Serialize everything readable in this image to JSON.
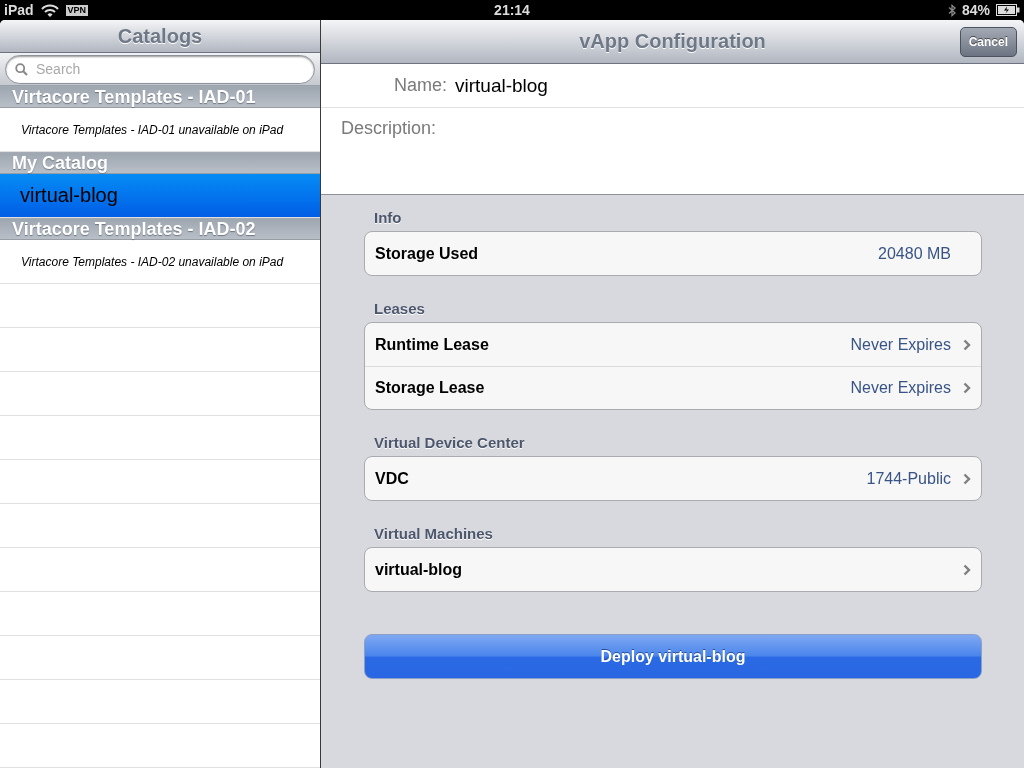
{
  "status_bar": {
    "device": "iPad",
    "vpn": "VPN",
    "time": "21:14",
    "battery": "84%"
  },
  "catalogs": {
    "title": "Catalogs",
    "search": {
      "placeholder": "Search"
    },
    "sections": [
      {
        "title": "Virtacore Templates - IAD-01",
        "items": [
          {
            "kind": "message",
            "text": "Virtacore Templates - IAD-01 unavailable on iPad"
          }
        ]
      },
      {
        "title": "My Catalog",
        "items": [
          {
            "kind": "item",
            "text": "virtual-blog",
            "selected": true
          }
        ]
      },
      {
        "title": "Virtacore Templates - IAD-02",
        "items": [
          {
            "kind": "message",
            "text": "Virtacore Templates - IAD-02 unavailable on iPad"
          }
        ]
      }
    ]
  },
  "configuration": {
    "title": "vApp Configuration",
    "cancel_button": "Cancel",
    "name": {
      "label": "Name:",
      "value": "virtual-blog"
    },
    "description": {
      "label": "Description:"
    },
    "groups": [
      {
        "title": "Info",
        "rows": [
          {
            "label": "Storage Used",
            "value": "20480 MB",
            "disclosure": false
          }
        ]
      },
      {
        "title": "Leases",
        "rows": [
          {
            "label": "Runtime Lease",
            "value": "Never Expires",
            "disclosure": true
          },
          {
            "label": "Storage Lease",
            "value": "Never Expires",
            "disclosure": true
          }
        ]
      },
      {
        "title": "Virtual Device Center",
        "rows": [
          {
            "label": "VDC",
            "value": "1744-Public",
            "disclosure": true
          }
        ]
      },
      {
        "title": "Virtual Machines",
        "rows": [
          {
            "label": "virtual-blog",
            "disclosure": true
          }
        ]
      }
    ],
    "deploy_button": "Deploy virtual-blog"
  }
}
